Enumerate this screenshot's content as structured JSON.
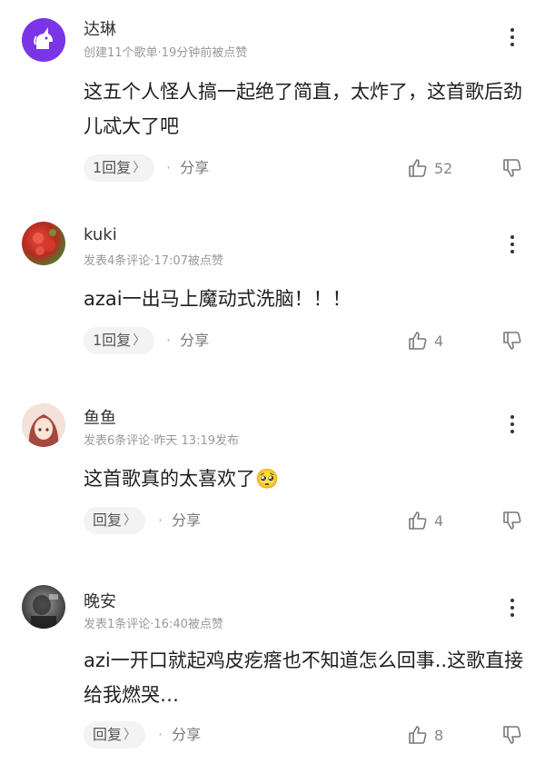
{
  "comments": [
    {
      "username": "达琳",
      "meta": "创建11个歌单·19分钟前被点赞",
      "text": "这五个人怪人搞一起绝了简直，太炸了，这首歌后劲儿忒大了吧",
      "reply_label": "1回复",
      "share_label": "分享",
      "likes": "52",
      "avatar": "unicorn"
    },
    {
      "username": "kuki",
      "meta": "发表4条评论·17:07被点赞",
      "text": "azai一出马上魔动式洗脑！！！",
      "reply_label": "1回复",
      "share_label": "分享",
      "likes": "4",
      "avatar": "red-photo"
    },
    {
      "username": "鱼鱼",
      "meta": "发表6条评论·昨天 13:19发布",
      "text": "这首歌真的太喜欢了🥺",
      "reply_label": "回复",
      "share_label": "分享",
      "likes": "4",
      "avatar": "anime-girl"
    },
    {
      "username": "晚安",
      "meta": "发表1条评论·16:40被点赞",
      "text": "azi一开口就起鸡皮疙瘩也不知道怎么回事..这歌直接给我燃哭…",
      "reply_label": "回复",
      "share_label": "分享",
      "likes": "8",
      "avatar": "dark-photo"
    }
  ],
  "colors": {
    "text": "#1f1f1f",
    "meta": "#999999",
    "unicorn_bg": "#7a35e6",
    "pill_bg": "#f3f3f3"
  }
}
